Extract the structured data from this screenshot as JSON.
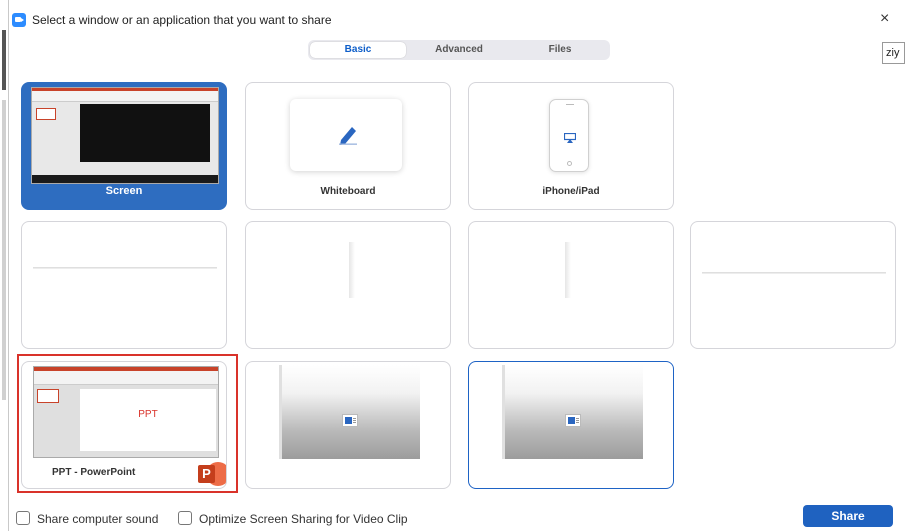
{
  "window": {
    "title": "Select a window or an application that you want to share",
    "close_glyph": "×",
    "side_tag": "ziy"
  },
  "tabs": [
    {
      "label": "Basic",
      "active": true
    },
    {
      "label": "Advanced",
      "active": false
    },
    {
      "label": "Files",
      "active": false
    }
  ],
  "cards": {
    "screen": {
      "label": "Screen",
      "selected": true
    },
    "whiteboard": {
      "label": "Whiteboard"
    },
    "iphone_ipad": {
      "label": "iPhone/iPad"
    },
    "ppt": {
      "label": "PPT - PowerPoint",
      "slide_text": "PPT",
      "app_icon_letter": "P"
    }
  },
  "footer": {
    "share_sound_label": "Share computer sound",
    "optimize_label": "Optimize Screen Sharing for Video Clip",
    "share_button": "Share"
  },
  "colors": {
    "accent": "#2e6dc0",
    "selected_outline": "#d9322a",
    "share_button": "#1f62c0"
  },
  "icons": [
    "zoom-app-icon",
    "close-icon",
    "pen-icon",
    "airplay-icon",
    "powerpoint-icon",
    "window-icon",
    "checkbox-icon"
  ]
}
